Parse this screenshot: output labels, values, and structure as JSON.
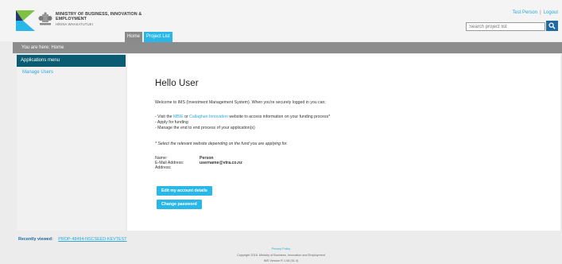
{
  "header": {
    "ministry_name": "MINISTRY OF BUSINESS, INNOVATION & EMPLOYMENT",
    "ministry_sub": "HĪKINA WHAKATUTUKI",
    "tabs": [
      {
        "label": "Home"
      },
      {
        "label": "Project List"
      }
    ],
    "user_name": "Test Person",
    "separator": "|",
    "logout_label": "Logout",
    "search": {
      "placeholder": "Search project list"
    }
  },
  "breadcrumb": "You are here: Home",
  "sidebar": {
    "header": "Applications menu",
    "items": [
      {
        "label": "Manage Users"
      }
    ]
  },
  "main": {
    "title": "Hello User",
    "welcome": "Welcome to IMS (Investment Management System). When you're securely logged in you can;",
    "list_visit_pre": "- Visit the ",
    "list_mbie": "MBIE",
    "list_or": " or ",
    "list_callaghan": "Callaghan Innovation",
    "list_visit_post": " website to access information on your funding process*",
    "list_apply": "- Apply for funding",
    "list_manage": "- Manage the end to end process of your application(s)",
    "note": "* Select the relevant website depending on the fund you are applying for.",
    "details": {
      "name_label": "Name:",
      "name_value": "Person",
      "email_label": "E-Mail Address:",
      "email_value": "username@vtra.co.nz",
      "address_label": "Address:",
      "address_value": ""
    },
    "edit_button": "Edit my account details",
    "password_button": "Change password"
  },
  "recently": {
    "label": "Recently viewed:",
    "value": "PROP-48494-NSCSEED-KEVTEST"
  },
  "footer": {
    "privacy": "Privacy Policy",
    "copyright": "Copyright 2016. Ministry of Business, Innovation and Employment",
    "version": "IMS Version R 1.08 (31.4)"
  },
  "colors": {
    "accent": "#29b7e8",
    "sidebar_header": "#0b5c72",
    "bar_grey": "#8c8c8c",
    "logo_green": "#7ec242",
    "logo_navy": "#243a6e"
  }
}
